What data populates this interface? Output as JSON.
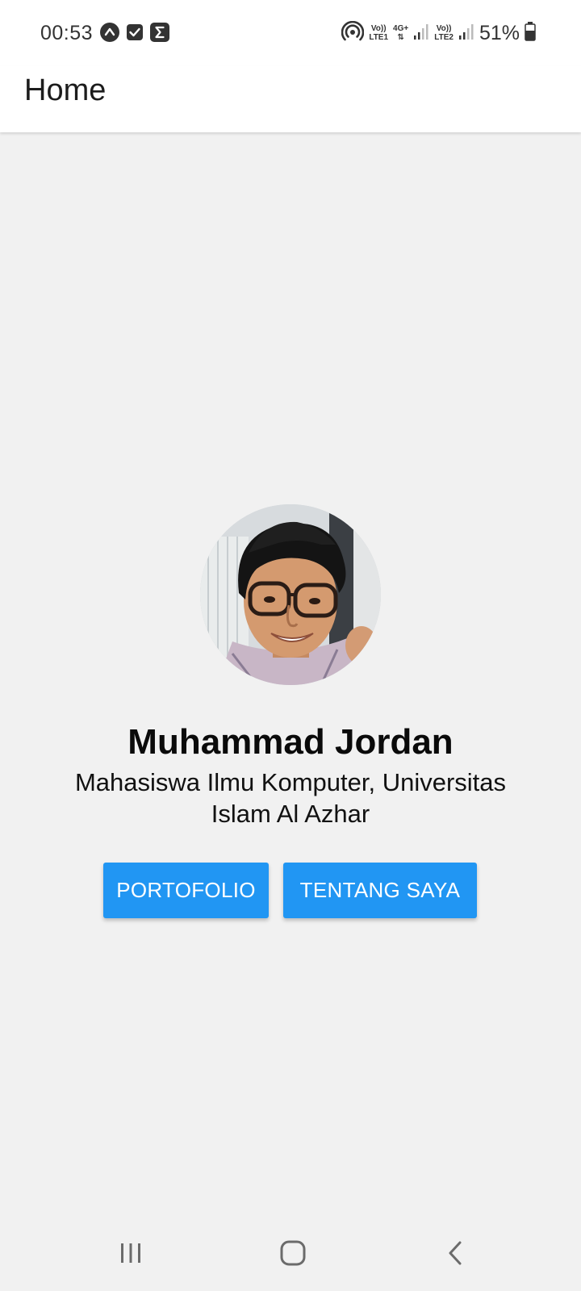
{
  "status_bar": {
    "time": "00:53",
    "left_icons": [
      "caret-up-badge-icon",
      "checkbox-icon",
      "sigma-icon"
    ],
    "hotspot_icon": "hotspot-icon",
    "sim1": {
      "top": "Vo))",
      "bottom": "LTE1"
    },
    "data_type": "4G+",
    "sim2": {
      "top": "Vo))",
      "bottom": "LTE2"
    },
    "battery": "51%"
  },
  "app_bar": {
    "title": "Home"
  },
  "profile": {
    "name": "Muhammad Jordan",
    "subtitle": "Mahasiswa Ilmu Komputer, Universitas Islam Al Azhar"
  },
  "buttons": {
    "portfolio_label": "PORTOFOLIO",
    "about_label": "TENTANG SAYA"
  },
  "nav_bar": {
    "recent_icon": "recent-apps-icon",
    "home_icon": "home-icon",
    "back_icon": "back-icon"
  },
  "colors": {
    "accent": "#2196f3",
    "background": "#f1f1f1",
    "app_bar": "#ffffff"
  }
}
